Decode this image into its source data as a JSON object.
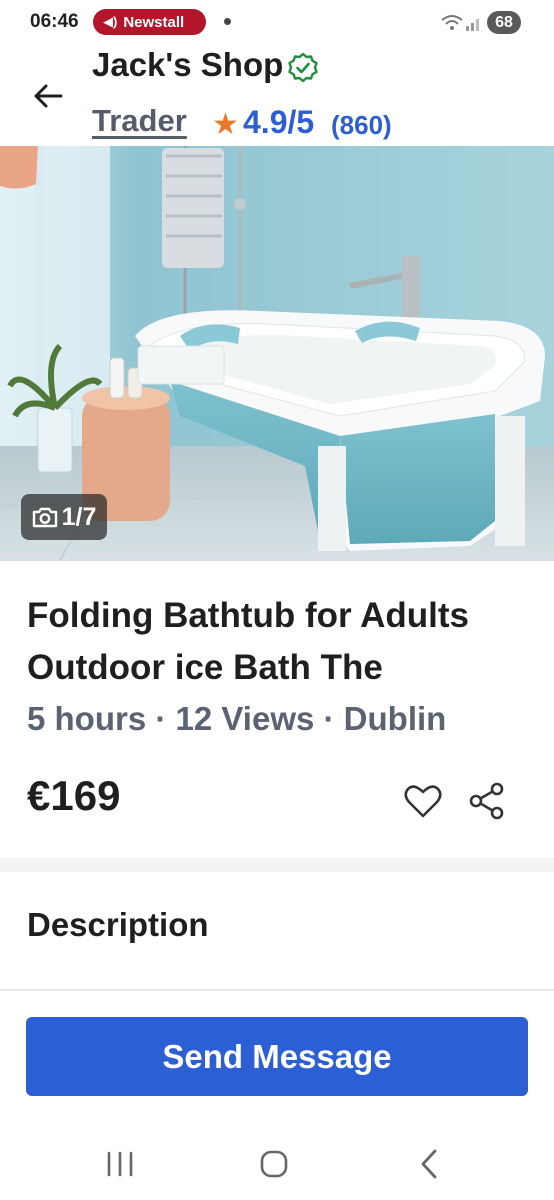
{
  "status_bar": {
    "time": "06:46",
    "notification_label": "Newstall",
    "battery": "68"
  },
  "header": {
    "shop_name": "Jack's Shop",
    "trader_label": "Trader",
    "rating": "4.9/5",
    "rating_count": "(860)"
  },
  "gallery": {
    "counter": "1/7"
  },
  "listing": {
    "title": "Folding Bathtub for Adults Outdoor ice Bath The",
    "meta": "5 hours · 12 Views · Dublin",
    "price": "€169"
  },
  "sections": {
    "description_heading": "Description"
  },
  "actions": {
    "send_message": "Send Message"
  },
  "icons": [
    "back-arrow-icon",
    "verified-icon",
    "star-icon",
    "camera-icon",
    "heart-icon",
    "share-icon",
    "wifi-icon"
  ],
  "colors": {
    "accent_blue": "#2c5fd4",
    "star_orange": "#e8782a",
    "verified_green": "#1e8e3e",
    "notification_red": "#b3152b"
  }
}
